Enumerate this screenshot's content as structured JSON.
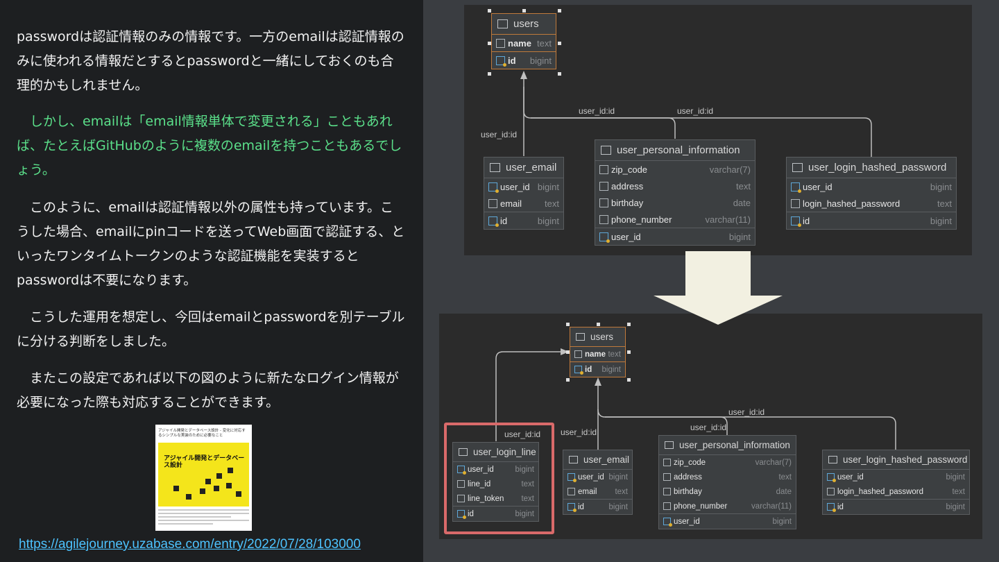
{
  "text": {
    "p1": "passwordは認証情報のみの情報です。一方のemailは認証情報のみに使われる情報だとするとpasswordと一緒にしておくのも合理的かもしれません。",
    "p2": "　しかし、emailは「email情報単体で変更される」こともあれば、たとえばGitHubのように複数のemailを持つこともあるでしょう。",
    "p3": "　このように、emailは認証情報以外の属性も持っています。こうした場合、emailにpinコードを送ってWeb画面で認証する、といったワンタイムトークンのような認証機能を実装するとpasswordは不要になります。",
    "p4": "　こうした運用を想定し、今回はemailとpasswordを別テーブルに分ける判断をしました。",
    "p5": "　またこの設定であれば以下の図のように新たなログイン情報が必要になった際も対応することができます。",
    "link": "https://agilejourney.uzabase.com/entry/2022/07/28/103000",
    "thumb_title": "アジャイル開発とデータベース設計 - 変化に対応するシンプルな実装のために必要なこと",
    "thumb_big": "アジャイル開発とデータベース設計"
  },
  "diagram_top": {
    "users": {
      "title": "users",
      "cols": [
        {
          "name": "name",
          "type": "text"
        }
      ],
      "pk": {
        "name": "id",
        "type": "bigint"
      }
    },
    "user_email": {
      "title": "user_email",
      "cols": [
        {
          "name": "user_id",
          "type": "bigint"
        },
        {
          "name": "email",
          "type": "text"
        }
      ],
      "pk": {
        "name": "id",
        "type": "bigint"
      }
    },
    "user_personal_information": {
      "title": "user_personal_information",
      "cols": [
        {
          "name": "zip_code",
          "type": "varchar(7)"
        },
        {
          "name": "address",
          "type": "text"
        },
        {
          "name": "birthday",
          "type": "date"
        },
        {
          "name": "phone_number",
          "type": "varchar(11)"
        }
      ],
      "pk": {
        "name": "user_id",
        "type": "bigint"
      }
    },
    "user_login_hashed_password": {
      "title": "user_login_hashed_password",
      "cols": [
        {
          "name": "user_id",
          "type": "bigint"
        },
        {
          "name": "login_hashed_password",
          "type": "text"
        }
      ],
      "pk": {
        "name": "id",
        "type": "bigint"
      }
    },
    "edge_labels": [
      "user_id:id",
      "user_id:id",
      "user_id:id"
    ]
  },
  "diagram_bottom": {
    "users": {
      "title": "users",
      "cols": [
        {
          "name": "name",
          "type": "text"
        }
      ],
      "pk": {
        "name": "id",
        "type": "bigint"
      }
    },
    "user_login_line": {
      "title": "user_login_line",
      "cols": [
        {
          "name": "user_id",
          "type": "bigint"
        },
        {
          "name": "line_id",
          "type": "text"
        },
        {
          "name": "line_token",
          "type": "text"
        }
      ],
      "pk": {
        "name": "id",
        "type": "bigint"
      }
    },
    "user_email": {
      "title": "user_email",
      "cols": [
        {
          "name": "user_id",
          "type": "bigint"
        },
        {
          "name": "email",
          "type": "text"
        }
      ],
      "pk": {
        "name": "id",
        "type": "bigint"
      }
    },
    "user_personal_information": {
      "title": "user_personal_information",
      "cols": [
        {
          "name": "zip_code",
          "type": "varchar(7)"
        },
        {
          "name": "address",
          "type": "text"
        },
        {
          "name": "birthday",
          "type": "date"
        },
        {
          "name": "phone_number",
          "type": "varchar(11)"
        }
      ],
      "pk": {
        "name": "user_id",
        "type": "bigint"
      }
    },
    "user_login_hashed_password": {
      "title": "user_login_hashed_password",
      "cols": [
        {
          "name": "user_id",
          "type": "bigint"
        },
        {
          "name": "login_hashed_password",
          "type": "text"
        }
      ],
      "pk": {
        "name": "id",
        "type": "bigint"
      }
    },
    "edge_labels": [
      "user_id:id",
      "user_id:id",
      "user_id:id",
      "user_id:id"
    ]
  },
  "colors": {
    "green_text": "#5be08a",
    "link": "#4dc3ff",
    "highlight_box": "#d96a6a",
    "selected_border": "#c07a3b",
    "arrow_fill": "#f2f0e1"
  }
}
